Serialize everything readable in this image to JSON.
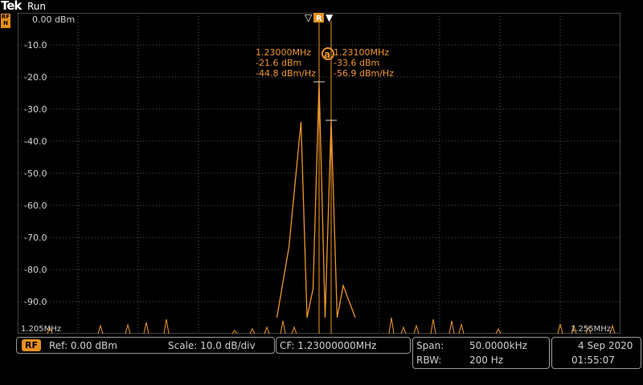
{
  "header": {
    "brand": "Tek",
    "status": "Run",
    "channel_badge": "RF N"
  },
  "y_axis": {
    "ref_label": "0.00 dBm",
    "ticks": [
      "-10.0",
      "-20.0",
      "-30.0",
      "-40.0",
      "-50.0",
      "-60.0",
      "-70.0",
      "-80.0",
      "-90.0"
    ]
  },
  "x_axis": {
    "left_label": "1.205MHz",
    "right_label": "1.255MHz"
  },
  "cursor_markers": {
    "left": "▽",
    "ref": "R",
    "right": "▼"
  },
  "cursor_a": {
    "freq": "1.23000MHz",
    "level": "-21.6 dBm",
    "density": "-44.8 dBm/Hz"
  },
  "cursor_b": {
    "freq": "1.23100MHz",
    "level": "-33.6 dBm",
    "density": "-56.9 dBm/Hz"
  },
  "cursor_badge": "a",
  "footer": {
    "rf_badge": "RF",
    "ref": "Ref: 0.00 dBm",
    "scale": "Scale: 10.0 dB/div",
    "cf": "CF:  1.23000000MHz",
    "span_label": "Span:",
    "span_value": "50.0000kHz",
    "rbw_label": "RBW:",
    "rbw_value": "200 Hz",
    "date": "4 Sep 2020",
    "time": "01:55:07"
  },
  "colors": {
    "trace": "#f0962a",
    "cursor": "#f0962a",
    "grid": "#5a5a5a",
    "text": "#d0d0d0",
    "accent": "#e8901e"
  },
  "chart_data": {
    "type": "line",
    "x_range_mhz": [
      1.205,
      1.255
    ],
    "y_range_dbm": [
      -100,
      0
    ],
    "series": [
      {
        "x": [
          1.2265,
          1.2275,
          1.2285,
          1.229,
          1.2295,
          1.23,
          1.2305,
          1.231,
          1.2315,
          1.232,
          1.233
        ],
        "values": [
          -95,
          -73,
          -34,
          -95,
          -86,
          -21.6,
          -95,
          -33.6,
          -95,
          -85,
          -95
        ]
      }
    ]
  }
}
